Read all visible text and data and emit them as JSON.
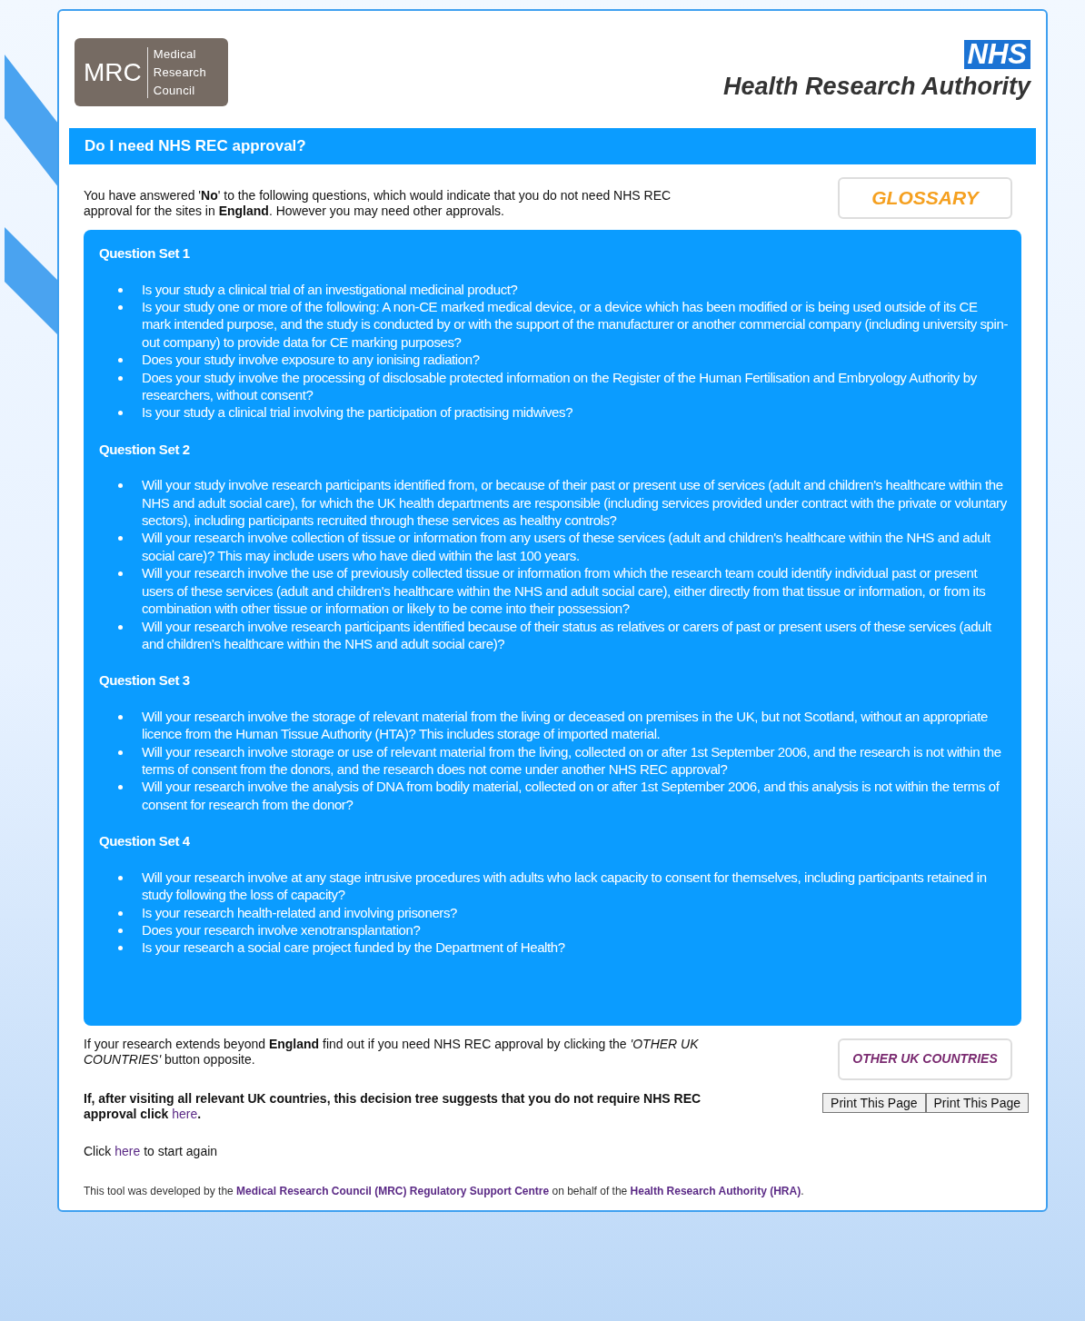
{
  "logos": {
    "mrc_short": "MRC",
    "mrc_full": [
      "Medical",
      "Research",
      "Council"
    ],
    "nhs": "NHS",
    "hra": "Health Research Authority"
  },
  "title": "Do I need NHS REC approval?",
  "intro": "You have answered '**No**' to the following questions, which would indicate that you do not need NHS REC approval for the sites in **England**. However you may need other approvals.",
  "glossary_button": "GLOSSARY",
  "question_sets": [
    {
      "title": "Question Set 1",
      "questions": [
        "Is your study a clinical trial of an investigational medicinal product?",
        "Is your study one or more of the following: A non-CE marked medical device, or a device which has been modified or is being used outside of its CE mark intended purpose, and the study is conducted by or with the support of the manufacturer or another commercial company (including university spin-out company) to provide data for CE marking purposes?",
        "Does your study involve exposure to any ionising radiation?",
        "Does your study involve the processing of disclosable protected information on the Register of the Human Fertilisation and Embryology Authority by researchers, without consent?",
        "Is your study a clinical trial involving the participation of practising midwives?"
      ]
    },
    {
      "title": "Question Set 2",
      "questions": [
        "Will your study involve research participants identified from, or because of their past or present use of services (adult and children's healthcare within the NHS and adult social care), for which the UK health departments are responsible (including services provided under contract with the private or voluntary sectors), including participants recruited through these services as healthy controls?",
        "Will your research involve collection of tissue or information from any users of these services (adult and children's healthcare within the NHS and adult social care)? This may include users who have died within the last 100 years.",
        "Will your research involve the use of previously collected tissue or information from which the research team could identify individual past or present users of these services (adult and children's healthcare within the NHS and adult social care), either directly from that tissue or information, or from its combination with other tissue or information or likely to be come into their possession?",
        "Will your research involve research participants identified because of their status as relatives or carers of past or present users of these services (adult and children's healthcare within the NHS and adult social care)?"
      ]
    },
    {
      "title": "Question Set 3",
      "questions": [
        "Will your research involve the storage of relevant material from the living or deceased on premises in the UK, but not Scotland, without an appropriate licence from the Human Tissue Authority (HTA)? This includes storage of imported material.",
        "Will your research involve storage or use of relevant material from the living, collected on or after 1st September 2006, and the research is not within the terms of consent from the donors, and the research does not come under another NHS REC approval?",
        "Will your research involve the analysis of DNA from bodily material, collected on or after 1st September 2006, and this analysis is not within the terms of consent for research from the donor?"
      ]
    },
    {
      "title": "Question Set 4",
      "questions": [
        "Will your research involve at any stage intrusive procedures with adults who lack capacity to consent for themselves, including participants retained in study following the loss of capacity?",
        "Is your research health-related and involving prisoners?",
        "Does your research involve xenotransplantation?",
        "Is your research a social care project funded by the Department of Health?"
      ]
    }
  ],
  "other_countries_text": "If your research extends beyond **England** find out if you need NHS REC approval by clicking the *'OTHER UK COUNTRIES'* button opposite.",
  "other_countries_button": "OTHER UK COUNTRIES",
  "approval_text": [
    {
      "kind": "text",
      "text": "If, after visiting all relevant UK countries, this decision tree suggests that you do not require NHS REC approval click "
    },
    {
      "kind": "link",
      "text": "here"
    },
    {
      "kind": "text",
      "text": "."
    }
  ],
  "print_buttons": [
    "Print This Page",
    "Print This Page"
  ],
  "restart_text": [
    {
      "kind": "text",
      "text": "Click "
    },
    {
      "kind": "link",
      "text": "here"
    },
    {
      "kind": "text",
      "text": " to start again"
    }
  ],
  "footer": [
    {
      "kind": "text",
      "text": "This tool was developed by the "
    },
    {
      "kind": "link",
      "text": "Medical Research Council (MRC) Regulatory Support Centre"
    },
    {
      "kind": "text",
      "text": " on behalf of the "
    },
    {
      "kind": "link",
      "text": "Health Research Authority (HRA)"
    },
    {
      "kind": "text",
      "text": "."
    }
  ]
}
